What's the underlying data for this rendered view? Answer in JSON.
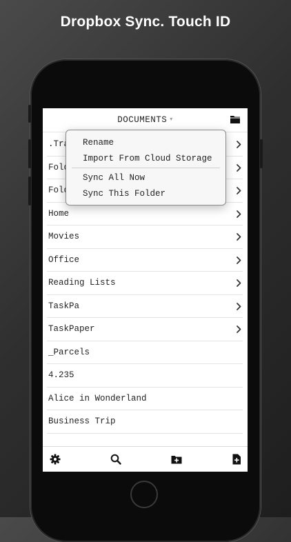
{
  "headline": "Dropbox Sync. Touch ID",
  "screen": {
    "title": "DOCUMENTS",
    "title_caret": "▾",
    "rows": [
      {
        "label": ".Tra",
        "chevron": true
      },
      {
        "label": "Fold",
        "chevron": true
      },
      {
        "label": "Fold",
        "chevron": true
      },
      {
        "label": "Home",
        "chevron": true
      },
      {
        "label": "Movies",
        "chevron": true
      },
      {
        "label": "Office",
        "chevron": true
      },
      {
        "label": "Reading Lists",
        "chevron": true
      },
      {
        "label": "TaskPa",
        "chevron": true
      },
      {
        "label": "TaskPaper",
        "chevron": true
      },
      {
        "label": "_Parcels",
        "chevron": false
      },
      {
        "label": "4.235",
        "chevron": false
      },
      {
        "label": "Alice in Wonderland",
        "chevron": false
      },
      {
        "label": "Business Trip",
        "chevron": false
      }
    ],
    "toolbar_icons": [
      "gear-icon",
      "search-icon",
      "folder-add-icon",
      "document-add-icon"
    ]
  },
  "menu": {
    "items": [
      "Rename",
      "Import From Cloud Storage",
      "Sync All Now",
      "Sync This Folder"
    ]
  },
  "colors": {
    "background_dark": "#2f2f2f",
    "phone_body": "#0b0b0b",
    "screen_bg": "#ffffff",
    "menu_bg": "#f7f7f7"
  }
}
